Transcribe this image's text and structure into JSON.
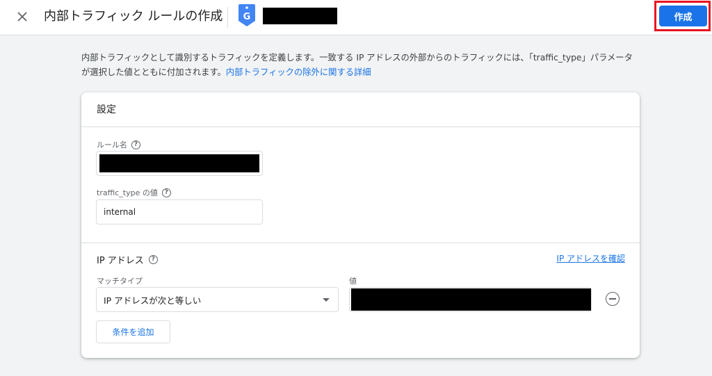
{
  "header": {
    "close_icon": "close-icon",
    "title": "内部トラフィック ルールの作成",
    "tag_icon": "google-tag-icon",
    "tag_icon_letter": "G",
    "create_label": "作成"
  },
  "description": {
    "text": "内部トラフィックとして識別するトラフィックを定義します。一致する IP アドレスの外部からのトラフィックには、「traffic_type」パラメータが選択した値とともに付加されます。",
    "link": "内部トラフィックの除外に関する詳細"
  },
  "card": {
    "title": "設定",
    "rule_name": {
      "label": "ルール名"
    },
    "traffic_type": {
      "label": "traffic_type の値",
      "value": "internal"
    },
    "ip_section": {
      "title": "IP アドレス",
      "verify_link": "IP アドレスを確認",
      "match_type_label": "マッチタイプ",
      "match_type_value": "IP アドレスが次と等しい",
      "value_label": "値",
      "add_condition": "条件を追加"
    }
  },
  "colors": {
    "accent": "#1a73e8",
    "highlight": "#e8131f",
    "background": "#f1f3f4"
  }
}
